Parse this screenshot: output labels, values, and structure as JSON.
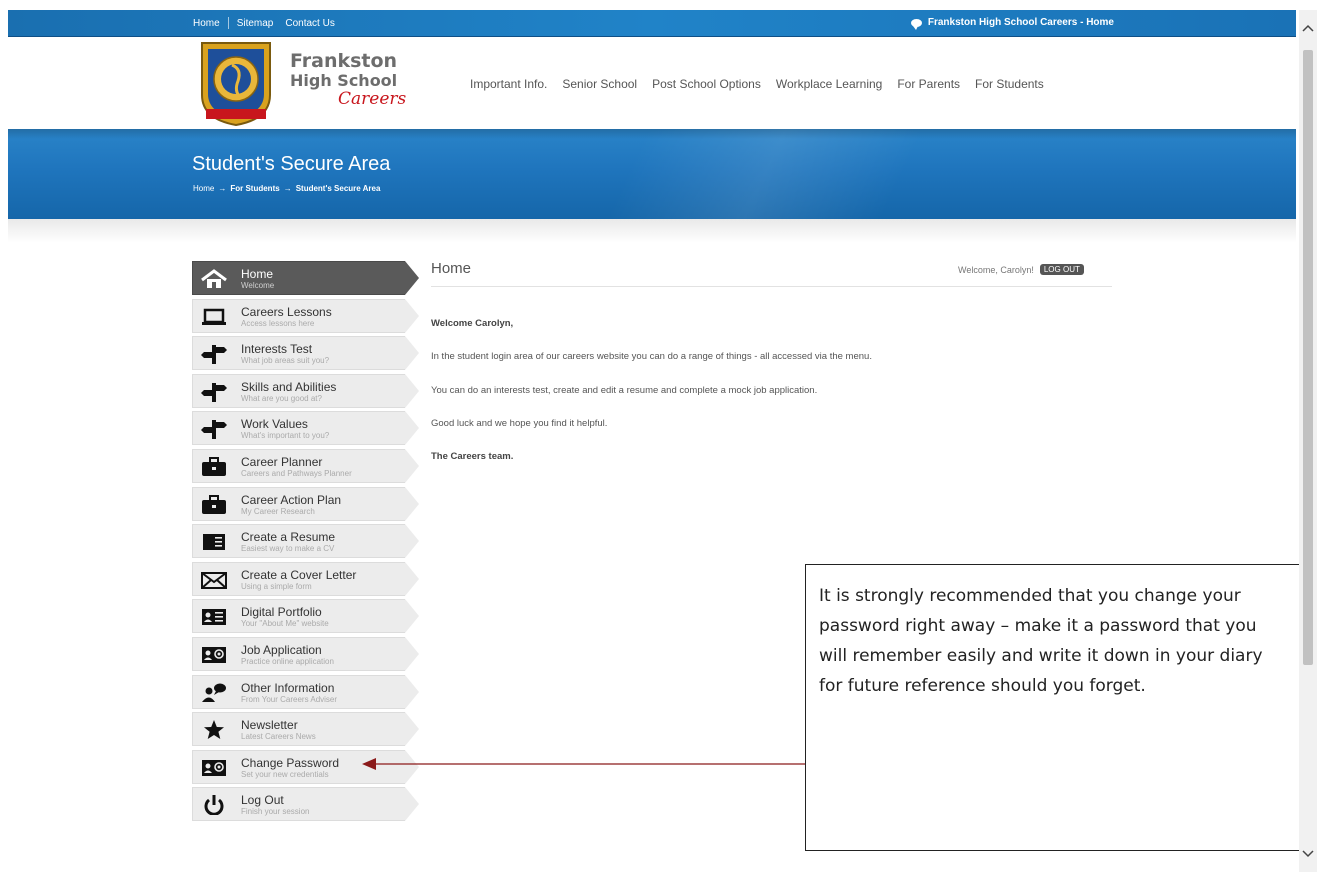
{
  "topbar": {
    "links": [
      "Home",
      "Sitemap",
      "Contact Us"
    ],
    "right_label": "Frankston High School Careers - Home"
  },
  "logo": {
    "line1": "Frankston",
    "line2": "High School",
    "line3": "Careers"
  },
  "nav": [
    "Important Info.",
    "Senior School",
    "Post School Options",
    "Workplace Learning",
    "For Parents",
    "For Students"
  ],
  "banner": {
    "title": "Student's Secure Area",
    "breadcrumb": [
      "Home",
      "For Students",
      "Student's Secure Area"
    ],
    "breadcrumb_separator": "→"
  },
  "sidebar": {
    "items": [
      {
        "label": "Home",
        "sub": "Welcome",
        "icon": "house-icon"
      },
      {
        "label": "Careers Lessons",
        "sub": "Access lessons here",
        "icon": "laptop-icon"
      },
      {
        "label": "Interests Test",
        "sub": "What job areas suit you?",
        "icon": "signpost-icon"
      },
      {
        "label": "Skills and Abilities",
        "sub": "What are you good at?",
        "icon": "signpost-icon"
      },
      {
        "label": "Work Values",
        "sub": "What's important to you?",
        "icon": "signpost-icon"
      },
      {
        "label": "Career Planner",
        "sub": "Careers and Pathways Planner",
        "icon": "briefcase-icon"
      },
      {
        "label": "Career Action Plan",
        "sub": "My Career Research",
        "icon": "briefcase-icon"
      },
      {
        "label": "Create a Resume",
        "sub": "Easiest way to make a CV",
        "icon": "document-icon"
      },
      {
        "label": "Create a Cover Letter",
        "sub": "Using a simple form",
        "icon": "envelope-icon"
      },
      {
        "label": "Digital Portfolio",
        "sub": "Your \"About Me\" website",
        "icon": "id-card-icon"
      },
      {
        "label": "Job Application",
        "sub": "Practice online application",
        "icon": "contact-card-icon"
      },
      {
        "label": "Other Information",
        "sub": "From Your Careers Adviser",
        "icon": "person-chat-icon"
      },
      {
        "label": "Newsletter",
        "sub": "Latest Careers News",
        "icon": "star-icon"
      },
      {
        "label": "Change Password",
        "sub": "Set your new credentials",
        "icon": "contact-card-icon"
      },
      {
        "label": "Log Out",
        "sub": "Finish your session",
        "icon": "power-icon"
      }
    ]
  },
  "content": {
    "title": "Home",
    "welcome": "Welcome, Carolyn!",
    "logout_label": "LOG OUT",
    "greeting": "Welcome Carolyn,",
    "para1": "In the student login area of our careers website you can do a range of things - all accessed via the menu.",
    "para2": "You can do an interests test, create and edit a resume and complete a mock job application.",
    "para3": "Good luck and we hope you find it helpful.",
    "signoff": "The Careers team."
  },
  "callout": {
    "text": "It is strongly recommended that you change your password right away – make it a password that you will remember easily and write it down in your diary for future reference should you forget."
  },
  "colors": {
    "topbar": "#2083c8",
    "banner": "#1f75bd",
    "active_menu": "#5a5a5a",
    "logo_red": "#c8161d",
    "arrow": "#8b1a1a"
  }
}
